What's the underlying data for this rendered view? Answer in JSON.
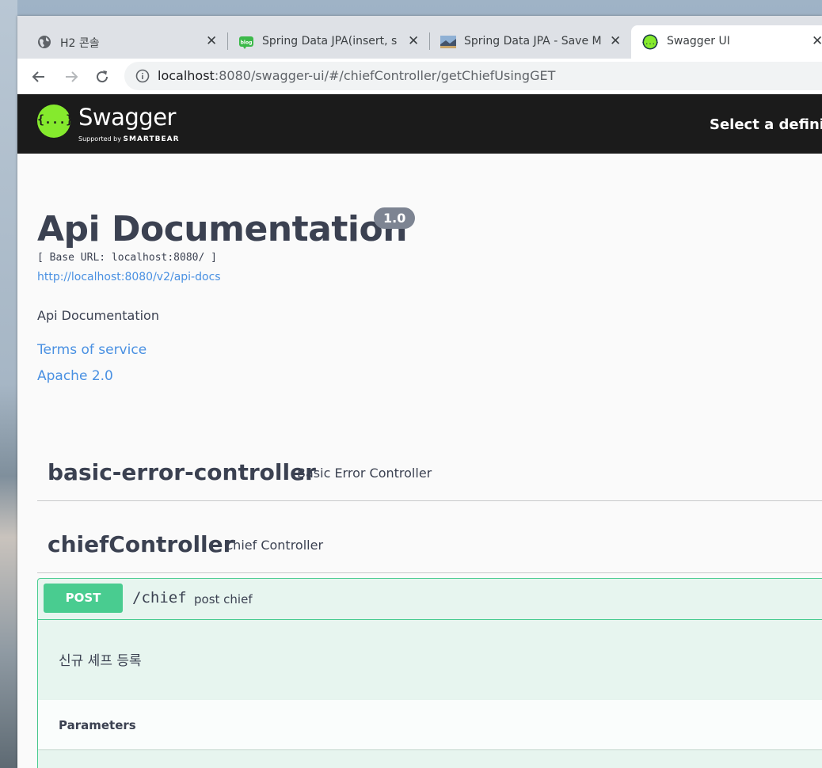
{
  "browser": {
    "tabs": [
      {
        "title": "H2 콘솔",
        "icon": "globe-icon"
      },
      {
        "title": "Spring Data JPA(insert, s",
        "icon": "blog-icon"
      },
      {
        "title": "Spring Data JPA - Save M",
        "icon": "landscape-thumbnail-icon"
      },
      {
        "title": "Swagger UI",
        "icon": "swagger-icon",
        "active": true
      }
    ],
    "url_host": "localhost",
    "url_rest": ":8080/swagger-ui/#/chiefController/getChiefUsingGET"
  },
  "swagger": {
    "logo_text": "Swagger",
    "logo_symbol": "{...}",
    "logo_sub_prefix": "Supported by",
    "logo_sub_brand": "SMARTBEAR",
    "select_definition": "Select a definit"
  },
  "info": {
    "title": "Api Documentation",
    "version": "1.0",
    "base_url": "[ Base URL: localhost:8080/ ]",
    "api_docs_link": "http://localhost:8080/v2/api-docs",
    "description": "Api Documentation",
    "terms": "Terms of service",
    "license": "Apache 2.0"
  },
  "tags": [
    {
      "name": "basic-error-controller",
      "description": "Basic Error Controller"
    },
    {
      "name": "chiefController",
      "description": "Chief Controller"
    }
  ],
  "operation": {
    "method": "POST",
    "path": "/chief",
    "summary": "post chief",
    "description": "신규 셰프 등록",
    "parameters_label": "Parameters"
  },
  "colors": {
    "post_green": "#49cc90",
    "swagger_green": "#85ea2d",
    "topbar": "#1b1b1b",
    "text": "#3b4151",
    "link": "#4990e2"
  }
}
